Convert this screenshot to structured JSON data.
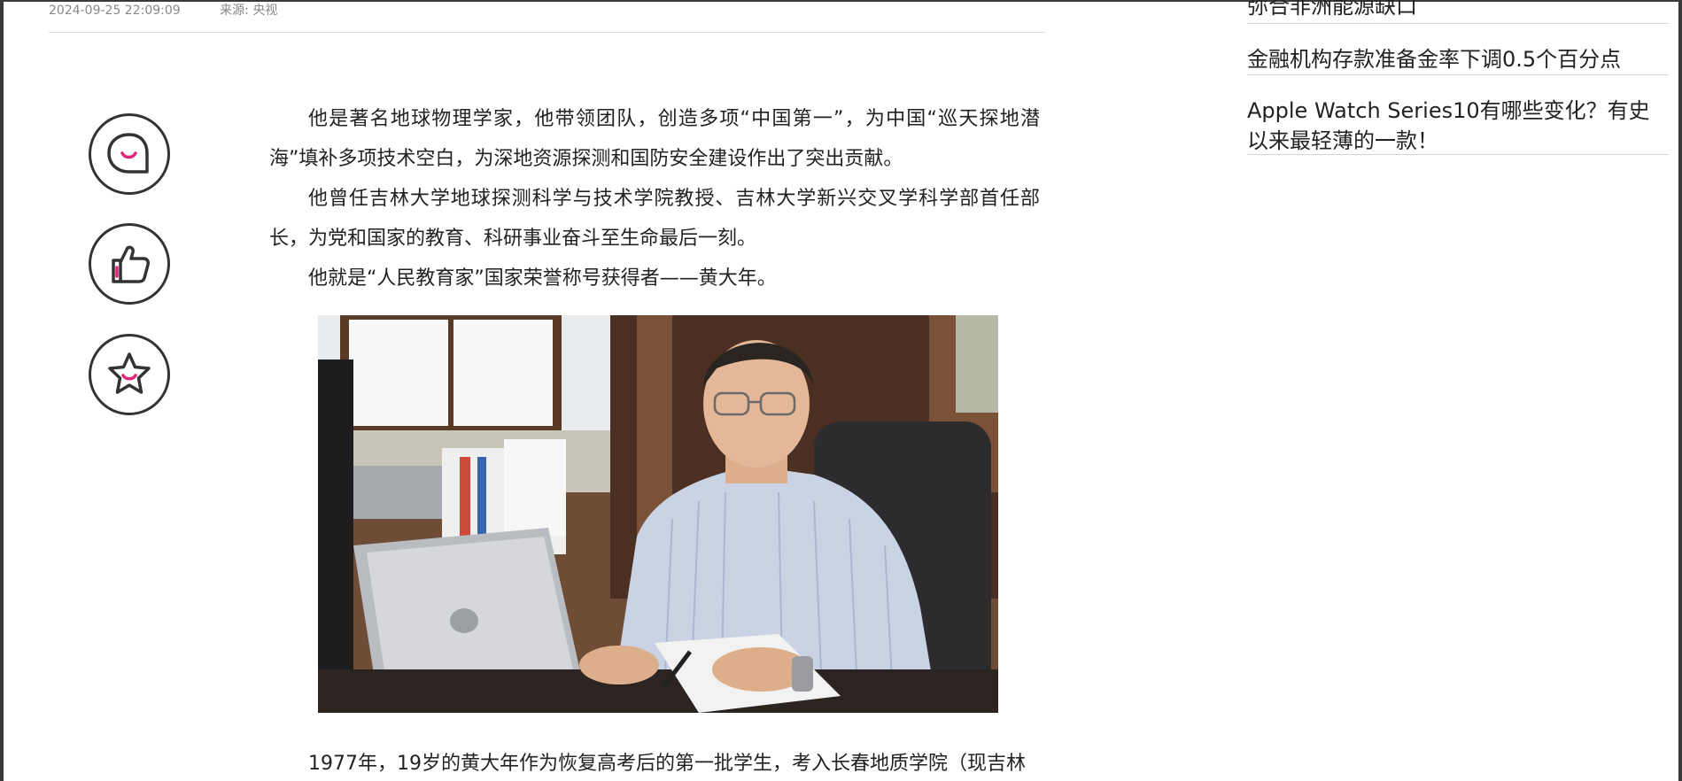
{
  "article": {
    "meta": {
      "datetime": "2024-09-25 22:09:09",
      "source": "来源: 央视"
    },
    "paragraphs": [
      "他是著名地球物理学家，他带领团队，创造多项“中国第一”，为中国“巡天探地潜海”填补多项技术空白，为深地资源探测和国防安全建设作出了突出贡献。",
      "他曾任吉林大学地球探测科学与技术学院教授、吉林大学新兴交叉学科学部首任部长，为党和国家的教育、科研事业奋斗至生命最后一刻。",
      "他就是“人民教育家”国家荣誉称号获得者——黄大年。"
    ],
    "last_paragraph": "1977年，19岁的黄大年作为恢复高考后的第一批学生，考入长春地质学院（现吉林"
  },
  "actions": {
    "accent_color": "#e0257a",
    "outline_color": "#333333",
    "items": [
      "comment-icon",
      "thumbs-up-icon",
      "star-icon"
    ]
  },
  "sidebar": {
    "news": [
      "弥合非洲能源缺口",
      "金融机构存款准备金率下调0.5个百分点",
      "Apple Watch Series10有哪些变化？有史以来最轻薄的一款！"
    ]
  }
}
